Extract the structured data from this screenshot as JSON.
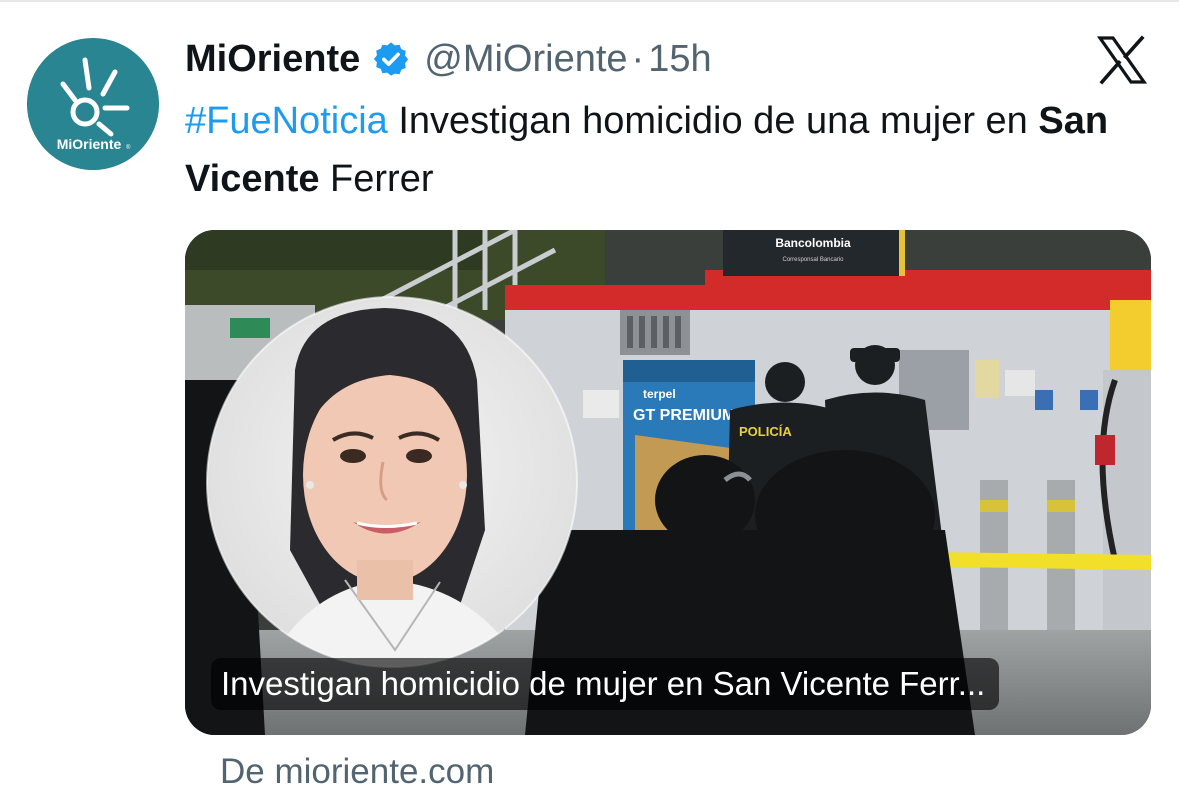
{
  "tweet": {
    "display_name": "MiOriente",
    "verified_icon": "verified-badge-icon",
    "handle": "@MiOriente",
    "separator": "·",
    "time": "15h",
    "platform_logo": "x-logo-icon",
    "text": {
      "hashtag": "#FueNoticia",
      "part1": " Investigan homicidio de una mujer en ",
      "bold": "San Vicente",
      "part2": " Ferrer"
    }
  },
  "avatar": {
    "logo_text": "MiOriente",
    "registered_mark": "®",
    "background_color": "#2a8592"
  },
  "link_card": {
    "caption": "Investigan homicidio de mujer en San Vicente Ferr...",
    "source": "De mioriente.com",
    "photo_signage": {
      "bank": "Bancolombia",
      "bank_sub": "Corresponsal Bancario",
      "station_brand": "terpel",
      "banner": "GT PREMIUM",
      "vest": "POLICÍA"
    }
  },
  "colors": {
    "accent": "#1d9bf0",
    "text_primary": "#0f1419",
    "text_secondary": "#536471"
  }
}
